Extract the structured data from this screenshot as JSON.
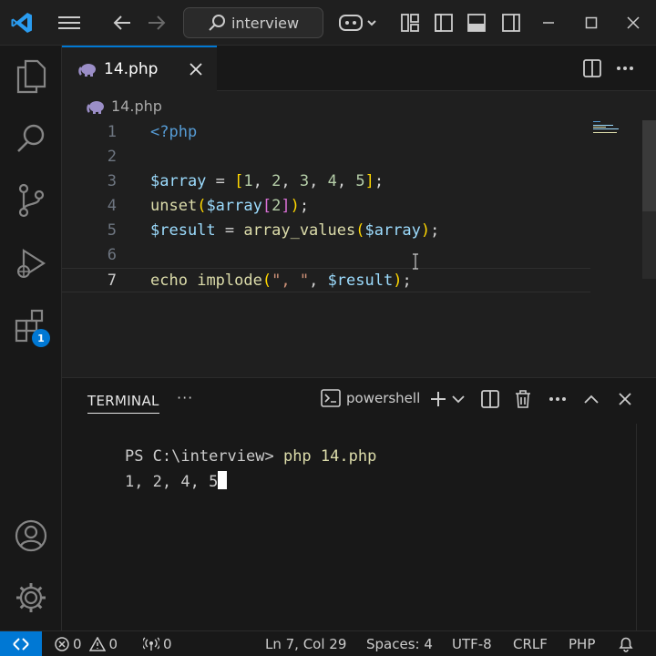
{
  "titlebar": {
    "search_text": "interview"
  },
  "activity": {
    "extensions_badge": "1"
  },
  "tab": {
    "label": "14.php"
  },
  "breadcrumb": {
    "file": "14.php"
  },
  "editor": {
    "line_numbers": [
      "1",
      "2",
      "3",
      "4",
      "5",
      "6",
      "7"
    ],
    "code": [
      "<?php",
      "",
      "$array = [1, 2, 3, 4, 5];",
      "unset($array[2]);",
      "$result = array_values($array);",
      "",
      "echo implode(\", \", $result);"
    ]
  },
  "panel": {
    "title": "TERMINAL",
    "more": "···",
    "shell": "powershell",
    "prompt": "PS C:\\interview> ",
    "command": "php 14.php",
    "output": "1, 2, 4, 5"
  },
  "status": {
    "errors": "0",
    "warnings": "0",
    "ports": "0",
    "position": "Ln 7, Col 29",
    "spaces": "Spaces: 4",
    "encoding": "UTF-8",
    "eol": "CRLF",
    "language": "PHP"
  },
  "colors": {
    "accent": "#0078d4",
    "background": "#1f1f1f",
    "sidebar": "#181818"
  }
}
